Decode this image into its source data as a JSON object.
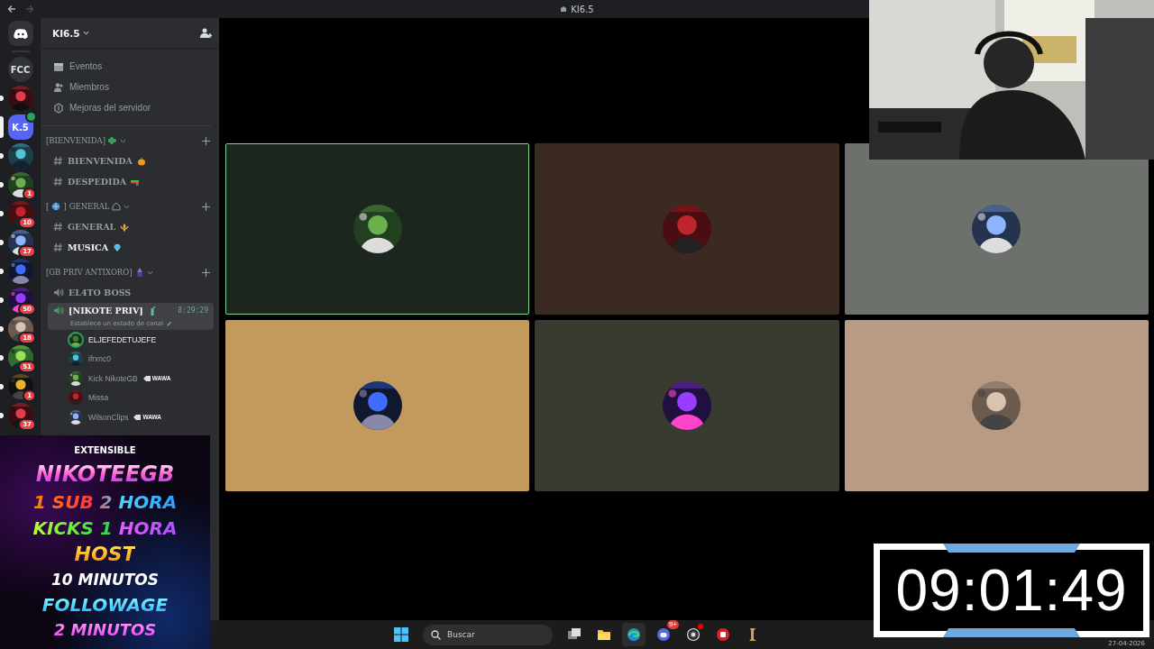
{
  "title_bar": {
    "title": "KI6.5"
  },
  "servers": [
    {
      "kind": "home",
      "unread": false,
      "selected": false
    },
    {
      "kind": "text",
      "label": "FCC",
      "unread": false,
      "selected": false
    },
    {
      "kind": "picture",
      "unread": true,
      "selected": false
    },
    {
      "kind": "text",
      "label": "K.5",
      "selected": true,
      "in_voice": true
    },
    {
      "kind": "picture",
      "unread": true,
      "selected": false
    },
    {
      "kind": "picture",
      "unread": true,
      "selected": false,
      "badge": "1"
    },
    {
      "kind": "picture",
      "unread": true,
      "selected": false,
      "badge": "10"
    },
    {
      "kind": "picture",
      "unread": true,
      "selected": false,
      "badge": "17"
    },
    {
      "kind": "picture",
      "unread": true,
      "selected": false
    },
    {
      "kind": "picture",
      "unread": true,
      "selected": false,
      "badge": "50"
    },
    {
      "kind": "picture",
      "unread": true,
      "selected": false,
      "badge": "18"
    },
    {
      "kind": "picture",
      "unread": true,
      "selected": false,
      "badge": "51"
    },
    {
      "kind": "picture",
      "unread": true,
      "selected": false,
      "badge": "1"
    },
    {
      "kind": "picture",
      "unread": true,
      "selected": false,
      "badge": "37"
    }
  ],
  "sidebar": {
    "server_name": "KI6.5",
    "menu": [
      {
        "kind": "calendar",
        "label": "Eventos"
      },
      {
        "kind": "members",
        "label": "Miembros"
      },
      {
        "kind": "boost",
        "label": "Mejoras del servidor"
      }
    ],
    "categories": [
      {
        "label": "[BIENVENIDA]",
        "channels": [
          {
            "kind": "text",
            "label": "BIENVENIDA",
            "unread": false,
            "selected": false
          },
          {
            "kind": "text",
            "label": "DESPEDIDA",
            "unread": false,
            "selected": false
          }
        ]
      },
      {
        "label_open": "[",
        "label_close": "]",
        "label": "GENERAL",
        "channels": [
          {
            "kind": "text",
            "label": "GENERAL",
            "unread": false,
            "selected": false
          },
          {
            "kind": "text",
            "label": "MUSICA",
            "unread": true,
            "selected": false
          }
        ]
      },
      {
        "label": "[GB PRIV ANTIXORO]",
        "channels": [
          {
            "kind": "voice",
            "label": "EL4TO BOSS",
            "unread": false,
            "selected": false
          },
          {
            "kind": "voice",
            "label": "[NIKOTE PRIV]",
            "unread": false,
            "selected": true,
            "time": "8:29:29",
            "status": "Establece un estado de canal",
            "users": [
              {
                "name": "ELJEFEDETUJEFE",
                "speaking": true
              },
              {
                "name": "ifrxnc0",
                "speaking": false
              },
              {
                "name": "Kick NikoteGB",
                "speaking": false,
                "tag": "WAWA"
              },
              {
                "name": "Missa",
                "speaking": false
              },
              {
                "name": "WilsonClips",
                "speaking": false,
                "tag": "WAWA"
              }
            ]
          }
        ]
      }
    ]
  },
  "tiles": [
    {
      "color": "#1d251f",
      "speaking": true
    },
    {
      "color": "#3a2a22",
      "speaking": false
    },
    {
      "color": "#6d716c",
      "speaking": false
    },
    {
      "color": "#c29a5e",
      "speaking": false
    },
    {
      "color": "#393b30",
      "speaking": false
    },
    {
      "color": "#b79b82",
      "speaking": false
    }
  ],
  "promo": {
    "lines": [
      {
        "kind": "small",
        "text": "EXTENSIBLE"
      },
      {
        "kind": "title",
        "text": "NIKOTEEGB"
      },
      {
        "kind": "sub",
        "text": "1 SUB 2 HORA"
      },
      {
        "kind": "kicks",
        "text": "KICKS 1 HORA"
      },
      {
        "kind": "host",
        "text": "HOST"
      },
      {
        "kind": "white",
        "text": "10 MINUTOS"
      },
      {
        "kind": "follow",
        "text": "FOLLOWAGE"
      },
      {
        "kind": "pink",
        "text": "2 MINUTOS"
      }
    ]
  },
  "timer": {
    "value": "09:01:49"
  },
  "taskbar": {
    "search": {
      "placeholder": "Buscar"
    },
    "apps": [
      {
        "kind": "taskview",
        "active": false
      },
      {
        "kind": "folder",
        "active": false
      },
      {
        "kind": "edge",
        "active": true
      },
      {
        "kind": "discord",
        "active": false,
        "badge": "9+"
      },
      {
        "kind": "obs",
        "active": false,
        "dot": true
      },
      {
        "kind": "red",
        "active": false
      },
      {
        "kind": "league",
        "active": false
      }
    ],
    "date": "27-04-2026"
  }
}
